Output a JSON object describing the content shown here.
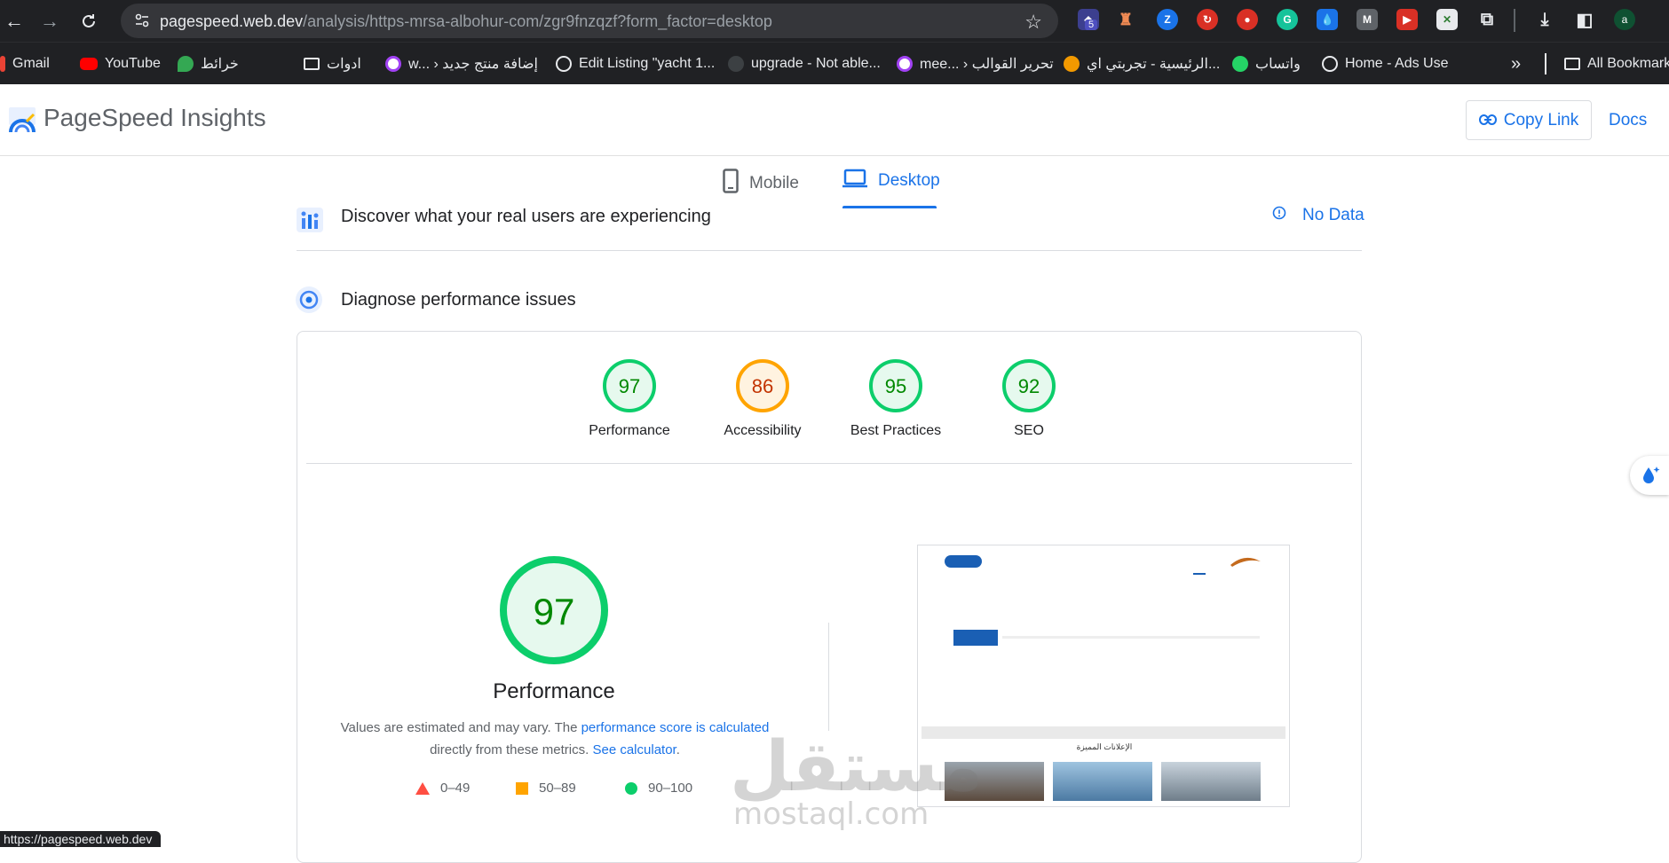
{
  "browser": {
    "url_host": "pagespeed.web.dev",
    "url_path": "/analysis/https-mrsa-albohur-com/zgr9fnzqzf?form_factor=desktop",
    "ext_badge": "5",
    "profile_initial": "a",
    "status_url": "https://pagespeed.web.dev"
  },
  "bookmarks": [
    {
      "label": "Gmail"
    },
    {
      "label": "YouTube"
    },
    {
      "label": "خرائط"
    },
    {
      "label": "ادوات"
    },
    {
      "label": "w... › إضافة منتج جديد"
    },
    {
      "label": "Edit Listing \"yacht 1..."
    },
    {
      "label": "upgrade - Not able..."
    },
    {
      "label": "mee... › تحرير القوالب"
    },
    {
      "label": "الرئيسية - تجربتي اي..."
    },
    {
      "label": "واتساب"
    },
    {
      "label": "Home - Ads Use"
    },
    {
      "label": "All Bookmark"
    }
  ],
  "header": {
    "title": "PageSpeed Insights",
    "copy_link": "Copy Link",
    "docs": "Docs"
  },
  "tabs": [
    {
      "label": "Mobile",
      "active": false
    },
    {
      "label": "Desktop",
      "active": true
    }
  ],
  "field_section": {
    "title": "Discover what your real users are experiencing",
    "status": "No Data"
  },
  "diagnose_section": {
    "title": "Diagnose performance issues"
  },
  "scores": [
    {
      "label": "Performance",
      "value": "97",
      "color": "#0cce6b",
      "text_color": "#008800"
    },
    {
      "label": "Accessibility",
      "value": "86",
      "color": "#ffa400",
      "text_color": "#c33300"
    },
    {
      "label": "Best Practices",
      "value": "95",
      "color": "#0cce6b",
      "text_color": "#008800"
    },
    {
      "label": "SEO",
      "value": "92",
      "color": "#0cce6b",
      "text_color": "#008800"
    }
  ],
  "main_score": {
    "value": "97",
    "label": "Performance",
    "note_prefix": "Values are estimated and may vary. The ",
    "note_link1": "performance score is calculated",
    "note_middle": "directly from these metrics. ",
    "note_link2": "See calculator",
    "note_suffix": "."
  },
  "legend": [
    {
      "range": "0–49",
      "color": "#ff4e42"
    },
    {
      "range": "50–89",
      "color": "#ffa400"
    },
    {
      "range": "90–100",
      "color": "#0cce6b"
    }
  ],
  "thumbnail": {
    "featured_heading": "الإعلانات المميزة"
  },
  "watermark": {
    "arabic": "مستقل",
    "latin": "mostaql.com"
  }
}
